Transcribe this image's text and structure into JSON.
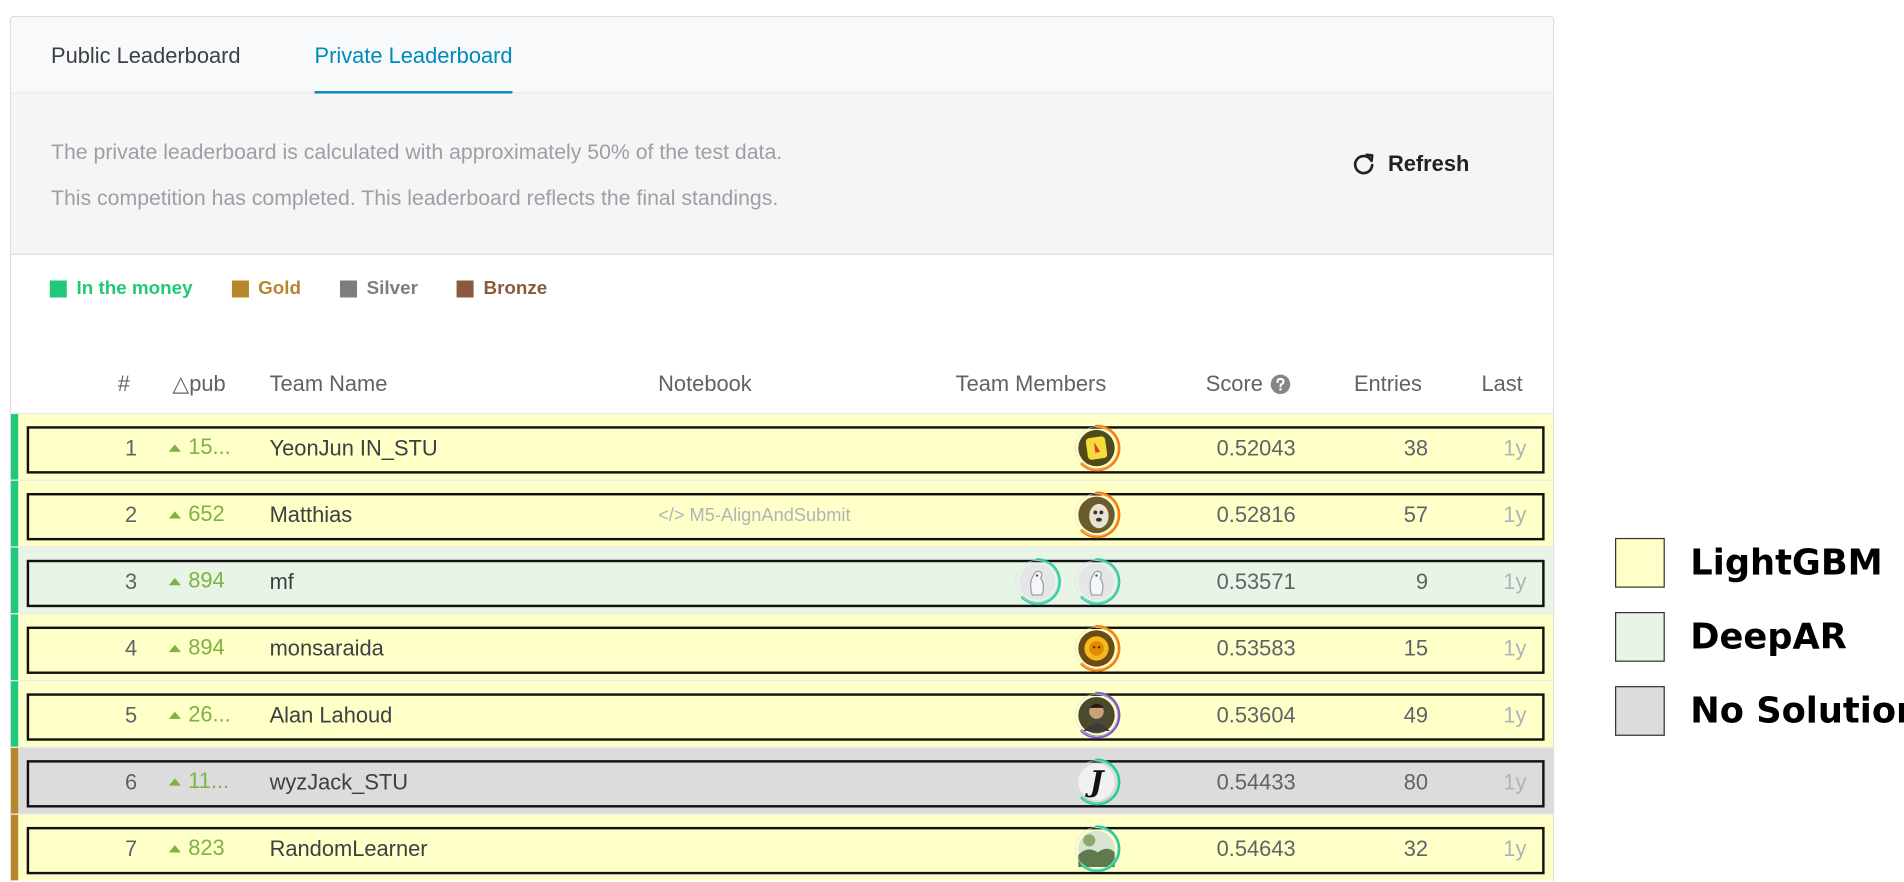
{
  "tabs": [
    {
      "label": "Public Leaderboard",
      "active": false
    },
    {
      "label": "Private Leaderboard",
      "active": true
    }
  ],
  "info": {
    "line1": "The private leaderboard is calculated with approximately 50% of the test data.",
    "line2": "This competition has completed. This leaderboard reflects the final standings.",
    "refresh_label": "Refresh"
  },
  "legend": [
    {
      "label": "In the money",
      "color": "#20c97a"
    },
    {
      "label": "Gold",
      "color": "#b8862b"
    },
    {
      "label": "Silver",
      "color": "#7d7d7d"
    },
    {
      "label": "Bronze",
      "color": "#8b5a3c"
    }
  ],
  "columns": {
    "rank": "#",
    "delta": "△pub",
    "team": "Team Name",
    "notebook": "Notebook",
    "members": "Team Members",
    "score": "Score",
    "entries": "Entries",
    "last": "Last"
  },
  "rows": [
    {
      "rank": "1",
      "delta": "15...",
      "team": "YeonJun IN_STU",
      "notebook": "",
      "score": "0.52043",
      "entries": "38",
      "last": "1y",
      "model": "LightGBM",
      "tier": "in-the-money",
      "avatars": [
        "yellow-sticker-avatar"
      ]
    },
    {
      "rank": "2",
      "delta": "652",
      "team": "Matthias",
      "notebook": "</> M5-AlignAndSubmit",
      "score": "0.52816",
      "entries": "57",
      "last": "1y",
      "model": "LightGBM",
      "tier": "in-the-money",
      "avatars": [
        "dog-photo-avatar"
      ]
    },
    {
      "rank": "3",
      "delta": "894",
      "team": "mf",
      "notebook": "",
      "score": "0.53571",
      "entries": "9",
      "last": "1y",
      "model": "DeepAR",
      "tier": "in-the-money",
      "avatars": [
        "default-duck-avatar",
        "default-duck-avatar"
      ]
    },
    {
      "rank": "4",
      "delta": "894",
      "team": "monsaraida",
      "notebook": "",
      "score": "0.53583",
      "entries": "15",
      "last": "1y",
      "model": "LightGBM",
      "tier": "in-the-money",
      "avatars": [
        "sun-face-avatar"
      ]
    },
    {
      "rank": "5",
      "delta": "26...",
      "team": "Alan Lahoud",
      "notebook": "",
      "score": "0.53604",
      "entries": "49",
      "last": "1y",
      "model": "LightGBM",
      "tier": "in-the-money",
      "avatars": [
        "person-photo-avatar"
      ]
    },
    {
      "rank": "6",
      "delta": "11...",
      "team": "wyzJack_STU",
      "notebook": "",
      "score": "0.54433",
      "entries": "80",
      "last": "1y",
      "model": "No Solution",
      "tier": "gold",
      "avatars": [
        "letter-j-avatar"
      ]
    },
    {
      "rank": "7",
      "delta": "823",
      "team": "RandomLearner",
      "notebook": "",
      "score": "0.54643",
      "entries": "32",
      "last": "1y",
      "model": "LightGBM",
      "tier": "gold",
      "avatars": [
        "landscape-photo-avatar"
      ]
    }
  ],
  "model_key": [
    {
      "label": "LightGBM",
      "color": "#ffffc8"
    },
    {
      "label": "DeepAR",
      "color": "#e8f4e6"
    },
    {
      "label": "No Solution",
      "color": "#dcdcdc"
    }
  ]
}
